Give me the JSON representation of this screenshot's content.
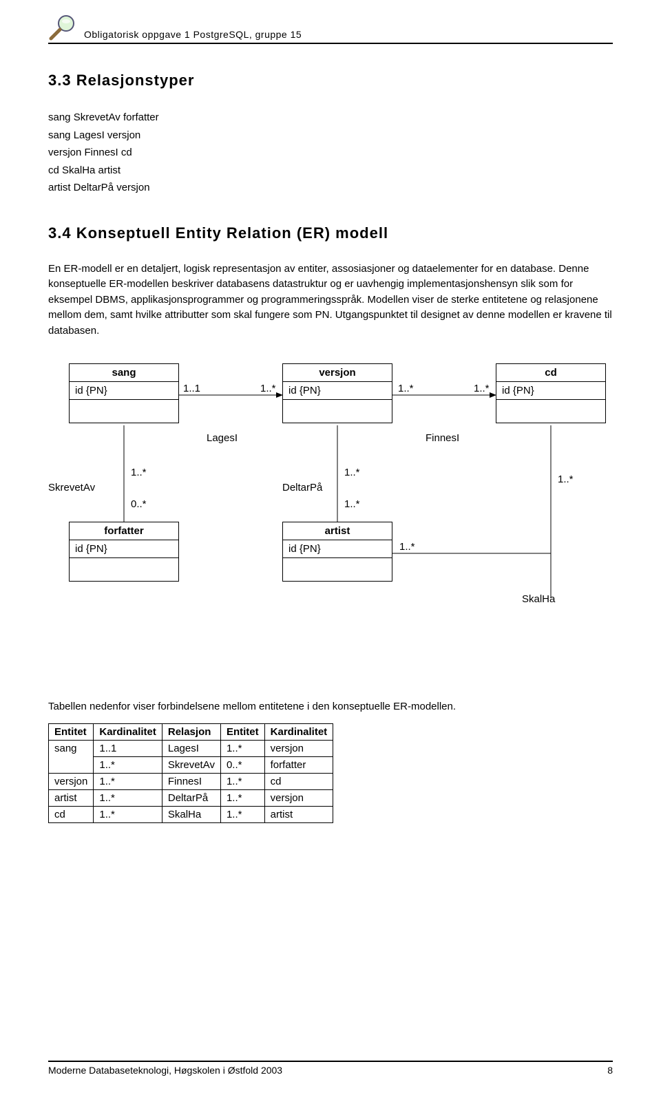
{
  "header": {
    "title": "Obligatorisk oppgave 1 PostgreSQL, gruppe 15"
  },
  "section33": {
    "heading": "3.3 Relasjonstyper",
    "lines": {
      "l1": "sang SkrevetAv forfatter",
      "l2": "sang LagesI versjon",
      "l3": "versjon FinnesI cd",
      "l4": "cd SkalHa artist",
      "l5": "artist DeltarPå versjon"
    }
  },
  "section34": {
    "heading": "3.4 Konseptuell Entity Relation (ER) modell",
    "paragraph": "En ER-modell er en detaljert, logisk representasjon av entiter, assosiasjoner og dataelementer for en database. Denne konseptuelle ER-modellen beskriver databasens datastruktur og er uavhengig implementasjonshensyn slik som for eksempel DBMS, applikasjonsprogrammer og programmeringsspråk. Modellen viser de sterke entitetene og relasjonene mellom dem, samt hvilke attributter som skal fungere som PN. Utgangspunktet til designet av denne modellen er kravene til databasen."
  },
  "entities": {
    "sang": {
      "title": "sang",
      "attr": "id {PN}"
    },
    "versjon": {
      "title": "versjon",
      "attr": "id {PN}"
    },
    "cd": {
      "title": "cd",
      "attr": "id {PN}"
    },
    "forfatter": {
      "title": "forfatter",
      "attr": "id {PN}"
    },
    "artist": {
      "title": "artist",
      "attr": "id {PN}"
    }
  },
  "labels": {
    "c11": "1..1",
    "c1s": "1..*",
    "c0s": "0..*",
    "lagesi": "LagesI",
    "finnesi": "FinnesI",
    "skrevetav": "SkrevetAv",
    "deltarpa": "DeltarPå",
    "skalha": "SkalHa"
  },
  "tableSection": {
    "intro": "Tabellen nedenfor viser forbindelsene mellom entitetene i den konseptuelle ER-modellen.",
    "headers": {
      "h1": "Entitet",
      "h2": "Kardinalitet",
      "h3": "Relasjon",
      "h4": "Entitet",
      "h5": "Kardinalitet"
    },
    "rows": [
      {
        "e1": "sang",
        "k1": "1..1",
        "rel": "LagesI",
        "k2": "1..*",
        "e2": "versjon"
      },
      {
        "e1": "",
        "k1": "1..*",
        "rel": "SkrevetAv",
        "k2": "0..*",
        "e2": "forfatter"
      },
      {
        "e1": "versjon",
        "k1": "1..*",
        "rel": "FinnesI",
        "k2": "1..*",
        "e2": "cd"
      },
      {
        "e1": "artist",
        "k1": "1..*",
        "rel": "DeltarPå",
        "k2": "1..*",
        "e2": "versjon"
      },
      {
        "e1": "cd",
        "k1": "1..*",
        "rel": "SkalHa",
        "k2": "1..*",
        "e2": "artist"
      }
    ]
  },
  "footer": {
    "left": "Moderne Databaseteknologi, Høgskolen i Østfold 2003",
    "right": "8"
  }
}
